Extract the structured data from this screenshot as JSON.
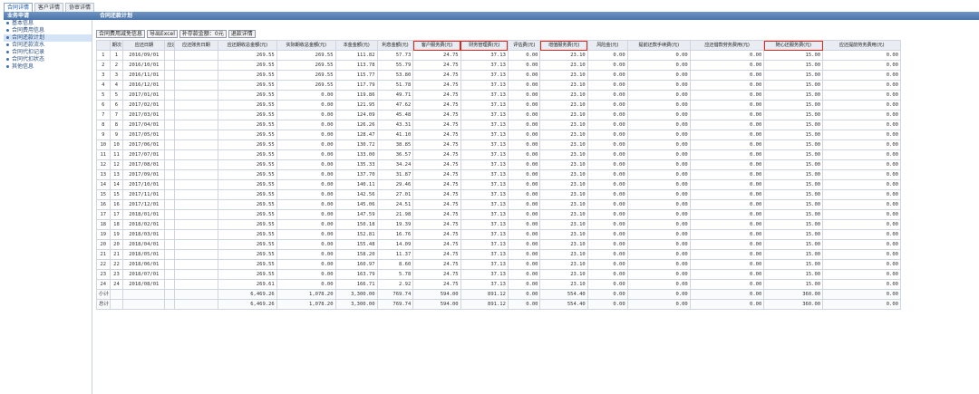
{
  "top_tabs": [
    "合同详情",
    "客户详情",
    "协审详情"
  ],
  "header": {
    "left_title": "业务申请",
    "main_title": "合同还款计划"
  },
  "sidebar": {
    "items": [
      "基本信息",
      "合同费用信息",
      "合同还款计划",
      "合同还款流水",
      "合同代扣记录",
      "合同代扣状态",
      "其他信息"
    ],
    "active_index": 2
  },
  "toolbar": {
    "buttons": [
      "合同费用减免信息",
      "导出Excel",
      "补存款金额：0元",
      "退款详情"
    ]
  },
  "columns": [
    "",
    "期次",
    "应还日期",
    "应还金额",
    "应还账务日期",
    "应还期收总金额(元)",
    "实际期收总金额(元)",
    "本金金额(元)",
    "利息金额(元)",
    "客户服务费(元)",
    "财务管理费(元)",
    "评估费(元)",
    "增值服务费(元)",
    "风险金(元)",
    "提前还款手续费(元)",
    "应还借款劳务费用(元)",
    "随心还服务费(元)",
    "应还提前劳务费用(元)"
  ],
  "highlighted_columns": [
    9,
    10,
    12,
    16
  ],
  "rows": [
    [
      "1",
      "1",
      "2016/09/01",
      "",
      "",
      "269.55",
      "269.55",
      "111.82",
      "57.73",
      "24.75",
      "37.13",
      "0.00",
      "23.10",
      "0.00",
      "0.00",
      "0.00",
      "15.00",
      "0.00"
    ],
    [
      "2",
      "2",
      "2016/10/01",
      "",
      "",
      "269.55",
      "269.55",
      "113.78",
      "55.79",
      "24.75",
      "37.13",
      "0.00",
      "23.10",
      "0.00",
      "0.00",
      "0.00",
      "15.00",
      "0.00"
    ],
    [
      "3",
      "3",
      "2016/11/01",
      "",
      "",
      "269.55",
      "269.55",
      "115.77",
      "53.80",
      "24.75",
      "37.13",
      "0.00",
      "23.10",
      "0.00",
      "0.00",
      "0.00",
      "15.00",
      "0.00"
    ],
    [
      "4",
      "4",
      "2016/12/01",
      "",
      "",
      "269.55",
      "269.55",
      "117.79",
      "51.78",
      "24.75",
      "37.13",
      "0.00",
      "23.10",
      "0.00",
      "0.00",
      "0.00",
      "15.00",
      "0.00"
    ],
    [
      "5",
      "5",
      "2017/01/01",
      "",
      "",
      "269.55",
      "0.00",
      "119.86",
      "49.71",
      "24.75",
      "37.13",
      "0.00",
      "23.10",
      "0.00",
      "0.00",
      "0.00",
      "15.00",
      "0.00"
    ],
    [
      "6",
      "6",
      "2017/02/01",
      "",
      "",
      "269.55",
      "0.00",
      "121.95",
      "47.62",
      "24.75",
      "37.13",
      "0.00",
      "23.10",
      "0.00",
      "0.00",
      "0.00",
      "15.00",
      "0.00"
    ],
    [
      "7",
      "7",
      "2017/03/01",
      "",
      "",
      "269.55",
      "0.00",
      "124.09",
      "45.48",
      "24.75",
      "37.13",
      "0.00",
      "23.10",
      "0.00",
      "0.00",
      "0.00",
      "15.00",
      "0.00"
    ],
    [
      "8",
      "8",
      "2017/04/01",
      "",
      "",
      "269.55",
      "0.00",
      "126.26",
      "43.31",
      "24.75",
      "37.13",
      "0.00",
      "23.10",
      "0.00",
      "0.00",
      "0.00",
      "15.00",
      "0.00"
    ],
    [
      "9",
      "9",
      "2017/05/01",
      "",
      "",
      "269.55",
      "0.00",
      "128.47",
      "41.10",
      "24.75",
      "37.13",
      "0.00",
      "23.10",
      "0.00",
      "0.00",
      "0.00",
      "15.00",
      "0.00"
    ],
    [
      "10",
      "10",
      "2017/06/01",
      "",
      "",
      "269.55",
      "0.00",
      "130.72",
      "38.85",
      "24.75",
      "37.13",
      "0.00",
      "23.10",
      "0.00",
      "0.00",
      "0.00",
      "15.00",
      "0.00"
    ],
    [
      "11",
      "11",
      "2017/07/01",
      "",
      "",
      "269.55",
      "0.00",
      "133.00",
      "36.57",
      "24.75",
      "37.13",
      "0.00",
      "23.10",
      "0.00",
      "0.00",
      "0.00",
      "15.00",
      "0.00"
    ],
    [
      "12",
      "12",
      "2017/08/01",
      "",
      "",
      "269.55",
      "0.00",
      "135.33",
      "34.24",
      "24.75",
      "37.13",
      "0.00",
      "23.10",
      "0.00",
      "0.00",
      "0.00",
      "15.00",
      "0.00"
    ],
    [
      "13",
      "13",
      "2017/09/01",
      "",
      "",
      "269.55",
      "0.00",
      "137.70",
      "31.87",
      "24.75",
      "37.13",
      "0.00",
      "23.10",
      "0.00",
      "0.00",
      "0.00",
      "15.00",
      "0.00"
    ],
    [
      "14",
      "14",
      "2017/10/01",
      "",
      "",
      "269.55",
      "0.00",
      "140.11",
      "29.46",
      "24.75",
      "37.13",
      "0.00",
      "23.10",
      "0.00",
      "0.00",
      "0.00",
      "15.00",
      "0.00"
    ],
    [
      "15",
      "15",
      "2017/11/01",
      "",
      "",
      "269.55",
      "0.00",
      "142.56",
      "27.01",
      "24.75",
      "37.13",
      "0.00",
      "23.10",
      "0.00",
      "0.00",
      "0.00",
      "15.00",
      "0.00"
    ],
    [
      "16",
      "16",
      "2017/12/01",
      "",
      "",
      "269.55",
      "0.00",
      "145.06",
      "24.51",
      "24.75",
      "37.13",
      "0.00",
      "23.10",
      "0.00",
      "0.00",
      "0.00",
      "15.00",
      "0.00"
    ],
    [
      "17",
      "17",
      "2018/01/01",
      "",
      "",
      "269.55",
      "0.00",
      "147.59",
      "21.98",
      "24.75",
      "37.13",
      "0.00",
      "23.10",
      "0.00",
      "0.00",
      "0.00",
      "15.00",
      "0.00"
    ],
    [
      "18",
      "18",
      "2018/02/01",
      "",
      "",
      "269.55",
      "0.00",
      "150.18",
      "19.39",
      "24.75",
      "37.13",
      "0.00",
      "23.10",
      "0.00",
      "0.00",
      "0.00",
      "15.00",
      "0.00"
    ],
    [
      "19",
      "19",
      "2018/03/01",
      "",
      "",
      "269.55",
      "0.00",
      "152.81",
      "16.76",
      "24.75",
      "37.13",
      "0.00",
      "23.10",
      "0.00",
      "0.00",
      "0.00",
      "15.00",
      "0.00"
    ],
    [
      "20",
      "20",
      "2018/04/01",
      "",
      "",
      "269.55",
      "0.00",
      "155.48",
      "14.09",
      "24.75",
      "37.13",
      "0.00",
      "23.10",
      "0.00",
      "0.00",
      "0.00",
      "15.00",
      "0.00"
    ],
    [
      "21",
      "21",
      "2018/05/01",
      "",
      "",
      "269.55",
      "0.00",
      "158.20",
      "11.37",
      "24.75",
      "37.13",
      "0.00",
      "23.10",
      "0.00",
      "0.00",
      "0.00",
      "15.00",
      "0.00"
    ],
    [
      "22",
      "22",
      "2018/06/01",
      "",
      "",
      "269.55",
      "0.00",
      "160.97",
      "8.60",
      "24.75",
      "37.13",
      "0.00",
      "23.10",
      "0.00",
      "0.00",
      "0.00",
      "15.00",
      "0.00"
    ],
    [
      "23",
      "23",
      "2018/07/01",
      "",
      "",
      "269.55",
      "0.00",
      "163.79",
      "5.78",
      "24.75",
      "37.13",
      "0.00",
      "23.10",
      "0.00",
      "0.00",
      "0.00",
      "15.00",
      "0.00"
    ],
    [
      "24",
      "24",
      "2018/08/01",
      "",
      "",
      "269.61",
      "0.00",
      "166.71",
      "2.92",
      "24.75",
      "37.13",
      "0.00",
      "23.10",
      "0.00",
      "0.00",
      "0.00",
      "15.00",
      "0.00"
    ]
  ],
  "summary_rows": [
    [
      "小计",
      "",
      "",
      "",
      "",
      "6,469.26",
      "1,078.20",
      "3,300.00",
      "769.74",
      "594.00",
      "891.12",
      "0.00",
      "554.40",
      "0.00",
      "0.00",
      "0.00",
      "360.00",
      "0.00"
    ],
    [
      "总计",
      "",
      "",
      "",
      "",
      "6,469.26",
      "1,078.20",
      "3,300.00",
      "769.74",
      "594.00",
      "891.12",
      "0.00",
      "554.40",
      "0.00",
      "0.00",
      "0.00",
      "360.00",
      "0.00"
    ]
  ],
  "colors": {
    "header_bar": "#4a73a8",
    "highlight": "#e0261a",
    "active_side": "#d4e3f6"
  }
}
